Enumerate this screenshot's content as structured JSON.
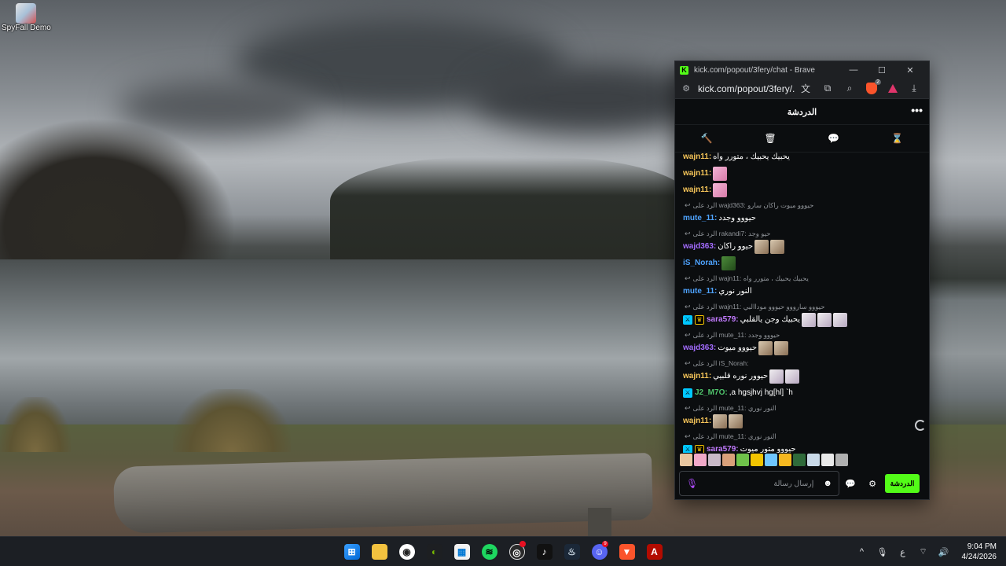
{
  "desktop": {
    "icon_label": "SpyFall Demo"
  },
  "window": {
    "title": "kick.com/popout/3fery/chat - Brave",
    "url": "kick.com/popout/3fery/...",
    "controls": {
      "minimize": "—",
      "maximize": "☐",
      "close": "✕"
    },
    "brave_badge": "2",
    "accent": "#53fc18"
  },
  "chat": {
    "header_title": "الدردشة",
    "more": "•••",
    "toolbar_icons": [
      "hammer-icon",
      "trash-icon",
      "chat-bubble-icon",
      "hourglass-icon"
    ],
    "username_colors": {
      "wajn11": "#f7c65a",
      "wajd363": "#a46cff",
      "mute_11": "#4ea3ff",
      "iS_Norah": "#4ea3ff",
      "sara579": "#c27bff",
      "J2_M7O": "#4fc36b"
    },
    "messages": [
      {
        "user": "wajn11",
        "text": "يحبيك يحبيك ، متورر واه",
        "emotes": 0
      },
      {
        "user": "wajn11",
        "text": "",
        "emotes": 1,
        "emote_style": "pink"
      },
      {
        "user": "wajn11",
        "text": "",
        "emotes": 1,
        "emote_style": "pink"
      },
      {
        "reply": "الرد على wajd363: حيووو ميوت راكان سارو",
        "user": "mute_11",
        "text": "حيووو وجدد",
        "emotes": 0
      },
      {
        "reply": "الرد على rakandi7: حيو وجد",
        "user": "wajd363",
        "text": "حيوو راكان",
        "emotes": 2,
        "emote_style": "cat"
      },
      {
        "user": "iS_Norah",
        "text": "",
        "emotes": 1,
        "emote_style": "fox"
      },
      {
        "reply": "الرد على wajn11: يحبيك يحبيك ، متورر واه",
        "user": "mute_11",
        "text": "النور نوري",
        "emotes": 0
      },
      {
        "reply": "الرد على wajn11: حيووو سارووو حيووو موداالبي",
        "user": "sara579",
        "text": "يحبيك وجن يالقلبي",
        "badges": [
          "mod",
          "vip"
        ],
        "emotes": 3,
        "emote_style": "white"
      },
      {
        "reply": "الرد على mute_11: حيووو وجدد",
        "user": "wajd363",
        "text": "حيووو ميوت",
        "emotes": 2,
        "emote_style": "cat"
      },
      {
        "reply": "الرد على iS_Norah:",
        "user": "wajn11",
        "text": "حيوور نوره قلبيي",
        "emotes": 2,
        "emote_style": "white"
      },
      {
        "user": "J2_M7O",
        "text": ",a hgsjhvj hg[hl] `h",
        "badges": [
          "mod"
        ],
        "emotes": 0
      },
      {
        "reply": "الرد على mute_11: النور نوري",
        "user": "wajn11",
        "text": "",
        "emotes": 2,
        "emote_style": "cat"
      },
      {
        "reply": "الرد على mute_11: النور نوري",
        "user": "sara579",
        "text": "حيووو متور ميوت",
        "badges": [
          "mod",
          "vip"
        ],
        "emotes": 0
      }
    ],
    "emote_bar_count": 12,
    "input_placeholder": "إرسال رسالة",
    "send_label": "الدردشة"
  },
  "taskbar": {
    "apps": [
      "windows-start",
      "file-explorer",
      "obs-studio",
      "nvidia",
      "microsoft-store",
      "spotify",
      "obs-recording",
      "tiktok",
      "steam",
      "discord",
      "brave",
      "adobe-acrobat"
    ],
    "discord_badge": "9",
    "tray": {
      "chevron": "^",
      "ime": "ع"
    },
    "time": "9:04 PM",
    "date": "4/24/2026"
  }
}
